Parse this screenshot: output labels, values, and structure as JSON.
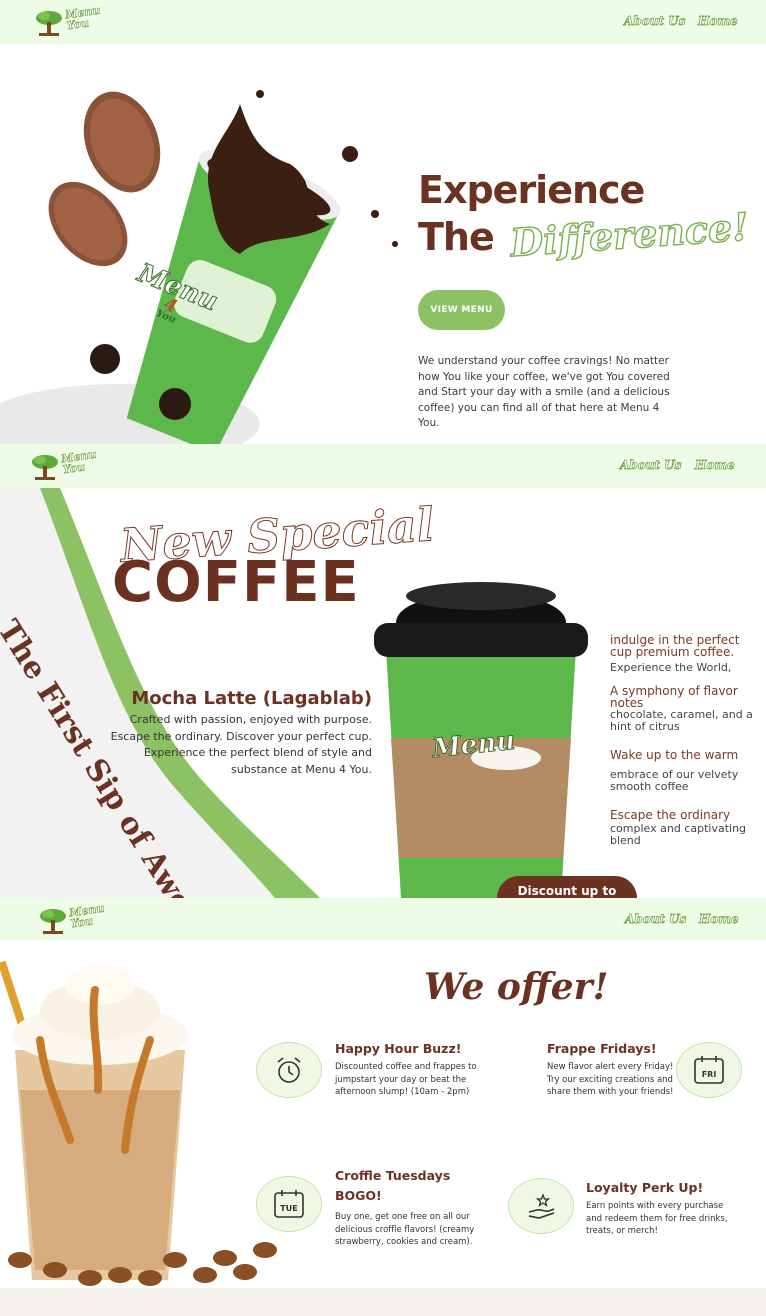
{
  "brand": {
    "logo_text_line1": "Menu",
    "logo_text_line2": "You",
    "logo_number": "4"
  },
  "nav": {
    "about": "About Us",
    "home": "Home"
  },
  "hero": {
    "line1": "Experience",
    "line2": "The",
    "script_word": "Difference!",
    "button": "VIEW MENU",
    "paragraph": "We understand your coffee cravings! No matter how You like your coffee, we've got You covered and Start your day with a smile (and a delicious coffee) you can find all of that here at Menu 4 You.",
    "cup_brand": "Menu",
    "cup_number": "4",
    "cup_you": "You"
  },
  "special": {
    "script_heading": "New Special",
    "heading": "COFFEE",
    "curve_text": "The First Sip of Awesomeness",
    "product_name": "Mocha Latte (Lagablab)",
    "product_desc": "Crafted with passion, enjoyed with purpose. Escape the ordinary. Discover your perfect cup. Experience the perfect blend of style and substance at Menu 4 You.",
    "cup_brand": "Menu",
    "discount": "Discount up to",
    "features": [
      {
        "title": "indulge in the perfect cup premium coffee.",
        "desc": "Experience the World,"
      },
      {
        "title": "A symphony of flavor notes",
        "desc": "chocolate, caramel, and a hint of citrus"
      },
      {
        "title": "Wake up to the warm",
        "desc": "embrace of our velvety smooth coffee"
      },
      {
        "title": "Escape the ordinary",
        "desc": "complex and captivating blend"
      }
    ]
  },
  "offers": {
    "heading": "We offer!",
    "items": [
      {
        "title": "Happy Hour Buzz!",
        "text": "Discounted coffee and frappes to jumpstart your day or beat the afternoon slump! (10am - 2pm)",
        "icon": "alarm-clock-icon"
      },
      {
        "title": "Frappe Fridays!",
        "text": "New flavor alert every Friday! Try our exciting creations and share them with your friends!",
        "icon": "calendar-fri-icon",
        "icon_label": "FRI"
      },
      {
        "title": "Croffle Tuesdays BOGO!",
        "text": "Buy one, get one free on all our delicious croffle flavors! (creamy strawberry, cookies and cream).",
        "icon": "calendar-tue-icon",
        "icon_label": "TUE"
      },
      {
        "title": "Loyalty Perk Up!",
        "text": "Earn points with every purchase and redeem them for free drinks, treats, or merch!",
        "icon": "hand-star-icon"
      }
    ]
  },
  "colors": {
    "brown": "#6b3222",
    "green": "#8dc264",
    "nav_bg": "#eefbe7",
    "cup_green": "#5cb84a"
  }
}
